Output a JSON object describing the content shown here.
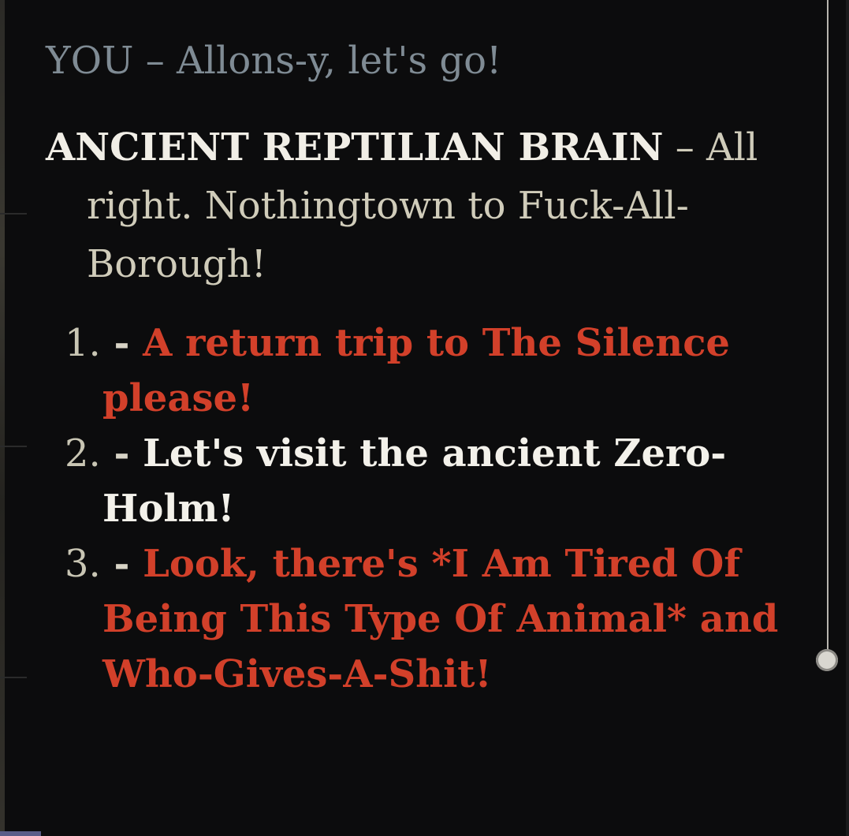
{
  "dialogue": {
    "you_line": "YOU – Allons-y, let's go!",
    "speaker": "ANCIENT REPTILIAN BRAIN",
    "speaker_dash": " – ",
    "speaker_text": "All right. Nothingtown to Fuck-All-Borough!"
  },
  "choices": [
    {
      "num": "1.",
      "dash": " - ",
      "text": "A return trip to The Silence please!",
      "color": "#d2402a"
    },
    {
      "num": "2.",
      "dash": " - ",
      "text": "Let's visit the ancient Zero-Holm!",
      "color": "#f3f1ea"
    },
    {
      "num": "3.",
      "dash": " - ",
      "text": "Look, there's *I Am Tired Of Being This Type Of Animal* and Who-Gives-A-Shit!",
      "color": "#d2402a"
    }
  ],
  "colors": {
    "background": "#0c0c0d",
    "you_text": "#7f8b94",
    "speaker_name": "#f1eee6",
    "speaker_text": "#d0ccba",
    "choice_red": "#d2402a",
    "choice_white": "#f3f1ea"
  }
}
